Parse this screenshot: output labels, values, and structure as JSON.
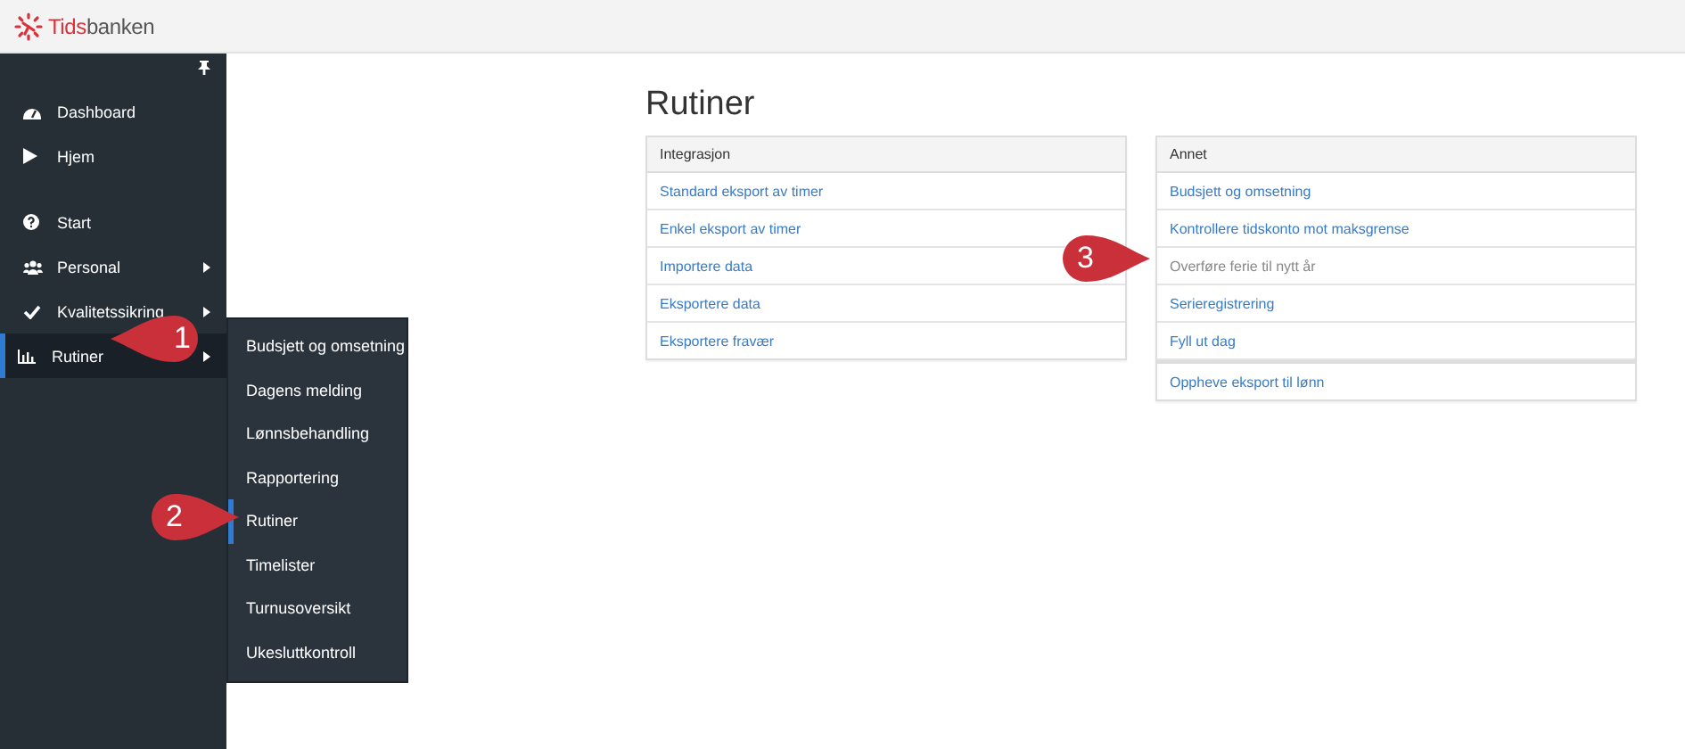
{
  "logo": {
    "part_1": "Tids",
    "part_2": "banken"
  },
  "sidebar": {
    "groups": [
      [
        {
          "label": "Dashboard",
          "has_submenu": false,
          "selected": false
        },
        {
          "label": "Hjem",
          "has_submenu": false,
          "selected": false
        }
      ],
      [
        {
          "label": "Start",
          "has_submenu": false,
          "selected": false
        },
        {
          "label": "Personal",
          "has_submenu": true,
          "selected": false
        },
        {
          "label": "Kvalitetssikring",
          "has_submenu": true,
          "selected": false
        },
        {
          "label": "Rutiner",
          "has_submenu": true,
          "selected": true
        }
      ]
    ]
  },
  "submenu": {
    "items": [
      {
        "label": "Budsjett og omsetning",
        "selected": false
      },
      {
        "label": "Dagens melding",
        "selected": false
      },
      {
        "label": "Lønnsbehandling",
        "selected": false
      },
      {
        "label": "Rapportering",
        "selected": false
      },
      {
        "label": "Rutiner",
        "selected": true
      },
      {
        "label": "Timelister",
        "selected": false
      },
      {
        "label": "Turnusoversikt",
        "selected": false
      },
      {
        "label": "Ukesluttkontroll",
        "selected": false
      }
    ]
  },
  "page_title": "Rutiner",
  "panels": [
    {
      "title": "Integrasjon",
      "items": [
        {
          "label": "Standard eksport av timer",
          "disabled": false
        },
        {
          "label": "Enkel eksport av timer",
          "disabled": false
        },
        {
          "label": "Importere data",
          "disabled": false
        },
        {
          "label": "Eksportere data",
          "disabled": false
        },
        {
          "label": "Eksportere fravær",
          "disabled": false
        }
      ]
    },
    {
      "title": "Annet",
      "items": [
        {
          "label": "Budsjett og omsetning",
          "disabled": false
        },
        {
          "label": "Kontrollere tidskonto mot maksgrense",
          "disabled": false
        },
        {
          "label": "Overføre ferie til nytt år",
          "disabled": true
        },
        {
          "label": "Serieregistrering",
          "disabled": false
        },
        {
          "label": "Fyll ut dag",
          "disabled": false
        },
        {
          "label": "Oppheve eksport til lønn",
          "disabled": false
        }
      ]
    }
  ],
  "callouts": [
    {
      "number": "1",
      "kind": "left"
    },
    {
      "number": "2",
      "kind": "right"
    },
    {
      "number": "3",
      "kind": "right"
    }
  ]
}
